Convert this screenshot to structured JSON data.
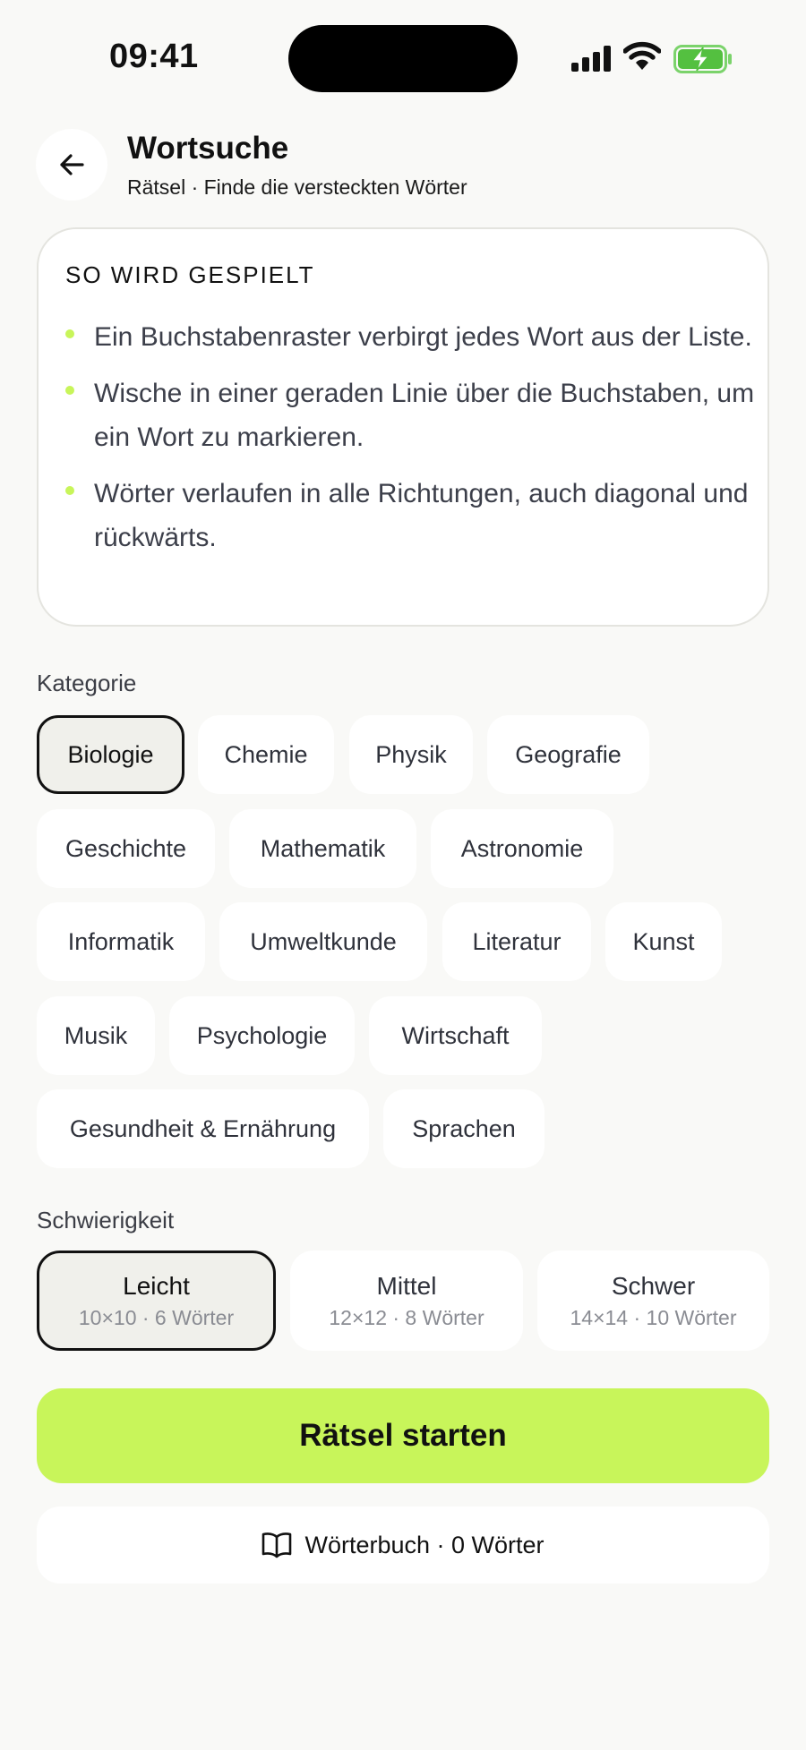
{
  "status_bar": {
    "time": "09:41",
    "icons": [
      "signal-icon",
      "wifi-icon",
      "battery-charging-icon"
    ]
  },
  "header": {
    "back_icon": "arrow-left-icon",
    "title": "Wortsuche",
    "subtitle": "Rätsel · Finde die versteckten Wörter"
  },
  "howto": {
    "title": "SO WIRD GESPIELT",
    "rules": [
      "Ein Buchstabenraster verbirgt jedes Wort aus der Liste.",
      "Wische in einer geraden Linie über die Buchstaben, um ein Wort zu markieren.",
      "Wörter verlaufen in alle Richtungen, auch diagonal und rückwärts."
    ]
  },
  "category": {
    "label": "Kategorie",
    "selected": "Biologie",
    "options": [
      "Biologie",
      "Chemie",
      "Physik",
      "Geografie",
      "Geschichte",
      "Mathematik",
      "Astronomie",
      "Informatik",
      "Umweltkunde",
      "Literatur",
      "Kunst",
      "Musik",
      "Psychologie",
      "Wirtschaft",
      "Gesundheit & Ernährung",
      "Sprachen"
    ]
  },
  "difficulty": {
    "label": "Schwierigkeit",
    "selected": "Leicht",
    "options": [
      {
        "name": "Leicht",
        "meta": "10×10 · 6 Wörter"
      },
      {
        "name": "Mittel",
        "meta": "12×12 · 8 Wörter"
      },
      {
        "name": "Schwer",
        "meta": "14×14 · 10 Wörter"
      }
    ]
  },
  "actions": {
    "start_label": "Rätsel starten",
    "dictionary_label": "Wörterbuch · 0 Wörter",
    "dictionary_icon": "book-open-icon"
  },
  "colors": {
    "accent": "#c8f55a",
    "background": "#f9f9f7",
    "selected_border": "#111111"
  }
}
